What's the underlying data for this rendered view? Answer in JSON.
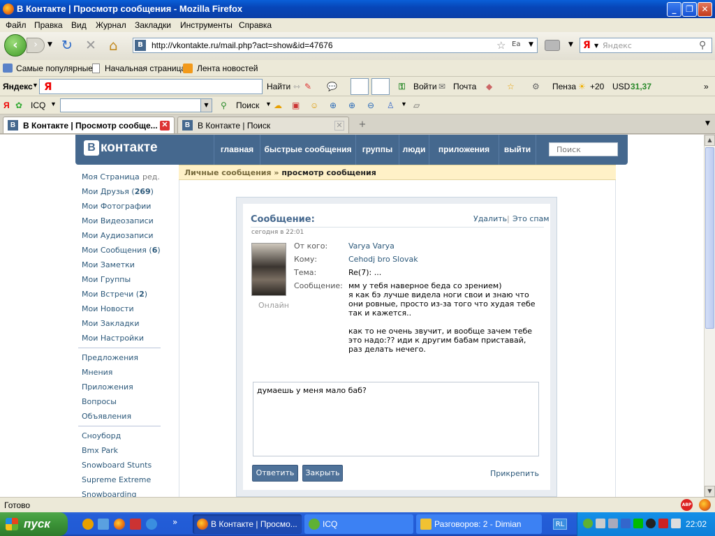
{
  "window": {
    "title": "В Контакте | Просмотр сообщения - Mozilla Firefox"
  },
  "menu": [
    "Файл",
    "Правка",
    "Вид",
    "Журнал",
    "Закладки",
    "Инструменты",
    "Справка"
  ],
  "nav": {
    "url": "http://vkontakte.ru/mail.php?act=show&id=47676",
    "search_placeholder": "Яндекс"
  },
  "bookmarks": [
    "Самые популярные",
    "Начальная страница",
    "Лента новостей"
  ],
  "yandex_bar": {
    "logo": "Яндекс",
    "find": "Найти",
    "login": "Войти",
    "mail": "Почта",
    "city": "Пенза",
    "temp": "+20",
    "usd_label": "USD",
    "usd_value": "31,37"
  },
  "icq_bar": {
    "icq": "ICQ",
    "search": "Поиск"
  },
  "tabs": [
    {
      "label": "В Контакте | Просмотр сообще..."
    },
    {
      "label": "В Контакте | Поиск"
    }
  ],
  "vk": {
    "logo_b": "В",
    "logo_text": "контакте",
    "nav": [
      "главная",
      "быстрые сообщения",
      "группы",
      "люди",
      "приложения",
      "выйти"
    ],
    "search_placeholder": "Поиск"
  },
  "leftnav": {
    "my_page": "Моя Страница",
    "edit": "ред.",
    "friends_label": "Мои Друзья",
    "friends_count": "269",
    "photos": "Мои Фотографии",
    "videos": "Мои Видеозаписи",
    "audio": "Мои Аудиозаписи",
    "messages_label": "Мои Сообщения",
    "messages_count": "6",
    "notes": "Мои Заметки",
    "groups": "Мои Группы",
    "meetings_label": "Мои Встречи",
    "meetings_count": "2",
    "news": "Мои Новости",
    "bookmarks": "Мои Закладки",
    "settings": "Мои Настройки",
    "section2": [
      "Предложения",
      "Мнения",
      "Приложения",
      "Вопросы",
      "Объявления"
    ],
    "section3": [
      "Сноуборд",
      "Bmx Park",
      "Snowboard Stunts",
      "Supreme Extreme",
      "Snowboarding"
    ]
  },
  "breadcrumb": {
    "part1": "Личные сообщения",
    "sep": " » ",
    "part2": "просмотр сообщения"
  },
  "message": {
    "heading": "Сообщение:",
    "delete": "Удалить",
    "divider": "|",
    "spam": "Это спам",
    "time": "сегодня в 22:01",
    "status": "Онлайн",
    "from_label": "От кого:",
    "from": "Varya Varya",
    "to_label": "Кому:",
    "to": "Cehodj bro Slovak",
    "subject_label": "Тема:",
    "subject": "Re(7): ...",
    "body_label": "Сообщение:",
    "body": "мм у тебя наверное беда со зрением)\nя как бэ лучше видела ноги свои и знаю что\nони ровные, просто из-за того что худая тебе\nтак и кажется..\n\nкак то не очень звучит, и вообще зачем тебе\nэто надо:?? иди к другим бабам приставай,\nраз делать нечего.",
    "reply_text": "думаешь у меня мало баб?",
    "reply_button": "Ответить",
    "close_button": "Закрыть",
    "attach": "Прикрепить"
  },
  "status_bar": {
    "text": "Готово"
  },
  "taskbar": {
    "start": "пуск",
    "tasks": [
      "В Контакте | Просмо...",
      "ICQ",
      "Разговоров: 2 - Dimian"
    ],
    "lang": "RL",
    "clock": "22:02"
  },
  "colors": {
    "vk_blue": "#45688e",
    "link": "#2b587a",
    "xp_blue": "#245ed8"
  }
}
